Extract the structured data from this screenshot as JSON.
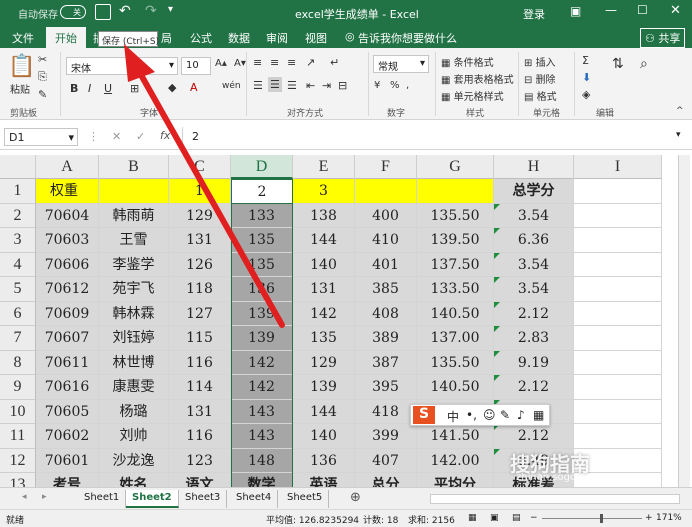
{
  "titlebar": {
    "autosave_label": "自动保存",
    "autosave_state": "关",
    "title": "excel学生成绩单  -  Excel",
    "login": "登录"
  },
  "tooltip": "保存 (Ctrl+S)",
  "tabs": {
    "file": "文件",
    "home": "开始",
    "insert": "插",
    "layout": "局",
    "formulas": "公式",
    "data": "数据",
    "review": "审阅",
    "view": "视图",
    "tell": "告诉我你想要做什么",
    "share": "共享"
  },
  "ribbon": {
    "paste": "粘贴",
    "clipboard": "剪贴板",
    "font_name": "宋体",
    "font_size": "10",
    "font_group": "字体",
    "align_group": "对齐方式",
    "number_format": "常规",
    "number_group": "数字",
    "cond_format": "条件格式",
    "table_format": "套用表格格式",
    "cell_style": "单元格样式",
    "style_group": "样式",
    "insert": "插入",
    "delete": "删除",
    "format": "格式",
    "cells_group": "单元格",
    "edit_group": "编辑",
    "bold": "B",
    "italic": "I",
    "underline": "U",
    "percent": "%"
  },
  "formula_bar": {
    "name_box": "D1",
    "fx": "fx",
    "value": "2"
  },
  "columns": [
    "A",
    "B",
    "C",
    "D",
    "E",
    "F",
    "G",
    "H",
    "I"
  ],
  "rows": [
    [
      "权重",
      "",
      "1",
      "2",
      "3",
      "",
      "",
      "总学分"
    ],
    [
      "70604",
      "韩雨萌",
      "129",
      "133",
      "138",
      "400",
      "135.50",
      "3.54"
    ],
    [
      "70603",
      "王雪",
      "131",
      "135",
      "144",
      "410",
      "139.50",
      "6.36"
    ],
    [
      "70606",
      "李鉴学",
      "126",
      "135",
      "140",
      "401",
      "137.50",
      "3.54"
    ],
    [
      "70612",
      "苑宇飞",
      "118",
      "136",
      "131",
      "385",
      "133.50",
      "3.54"
    ],
    [
      "70609",
      "韩林霖",
      "127",
      "139",
      "142",
      "408",
      "140.50",
      "2.12"
    ],
    [
      "70607",
      "刘钰婷",
      "115",
      "139",
      "135",
      "389",
      "137.00",
      "2.83"
    ],
    [
      "70611",
      "林世博",
      "116",
      "142",
      "129",
      "387",
      "135.50",
      "9.19"
    ],
    [
      "70616",
      "康惠雯",
      "114",
      "142",
      "139",
      "395",
      "140.50",
      "2.12"
    ],
    [
      "70605",
      "杨璐",
      "131",
      "143",
      "144",
      "418",
      "143.50",
      "0.71"
    ],
    [
      "70602",
      "刘帅",
      "116",
      "143",
      "140",
      "399",
      "141.50",
      "2.12"
    ],
    [
      "70601",
      "沙龙逸",
      "123",
      "148",
      "136",
      "407",
      "142.00",
      "8.49"
    ],
    [
      "考号",
      "姓名",
      "语文",
      "数学",
      "英语",
      "总分",
      "平均分",
      "标准差"
    ]
  ],
  "row_numbers": [
    "1",
    "2",
    "3",
    "4",
    "5",
    "6",
    "7",
    "8",
    "9",
    "10",
    "11",
    "12",
    "13"
  ],
  "sheets": [
    "Sheet1",
    "Sheet2",
    "Sheet3",
    "Sheet4",
    "Sheet5"
  ],
  "status": {
    "ready": "就绪",
    "average": "平均值: 126.8235294",
    "count": "计数: 18",
    "sum": "求和: 2156",
    "zoom": "171%"
  },
  "ime": {
    "mode": "中"
  },
  "watermark": {
    "main": "搜狗指南",
    "sub": "zhinan.sogou.com"
  },
  "colors": {
    "excel_green": "#217346",
    "header_yellow": "#ffff00",
    "selection_gray": "#a6a6a6",
    "data_gray": "#d9d9d9",
    "arrow_red": "#e02020"
  }
}
